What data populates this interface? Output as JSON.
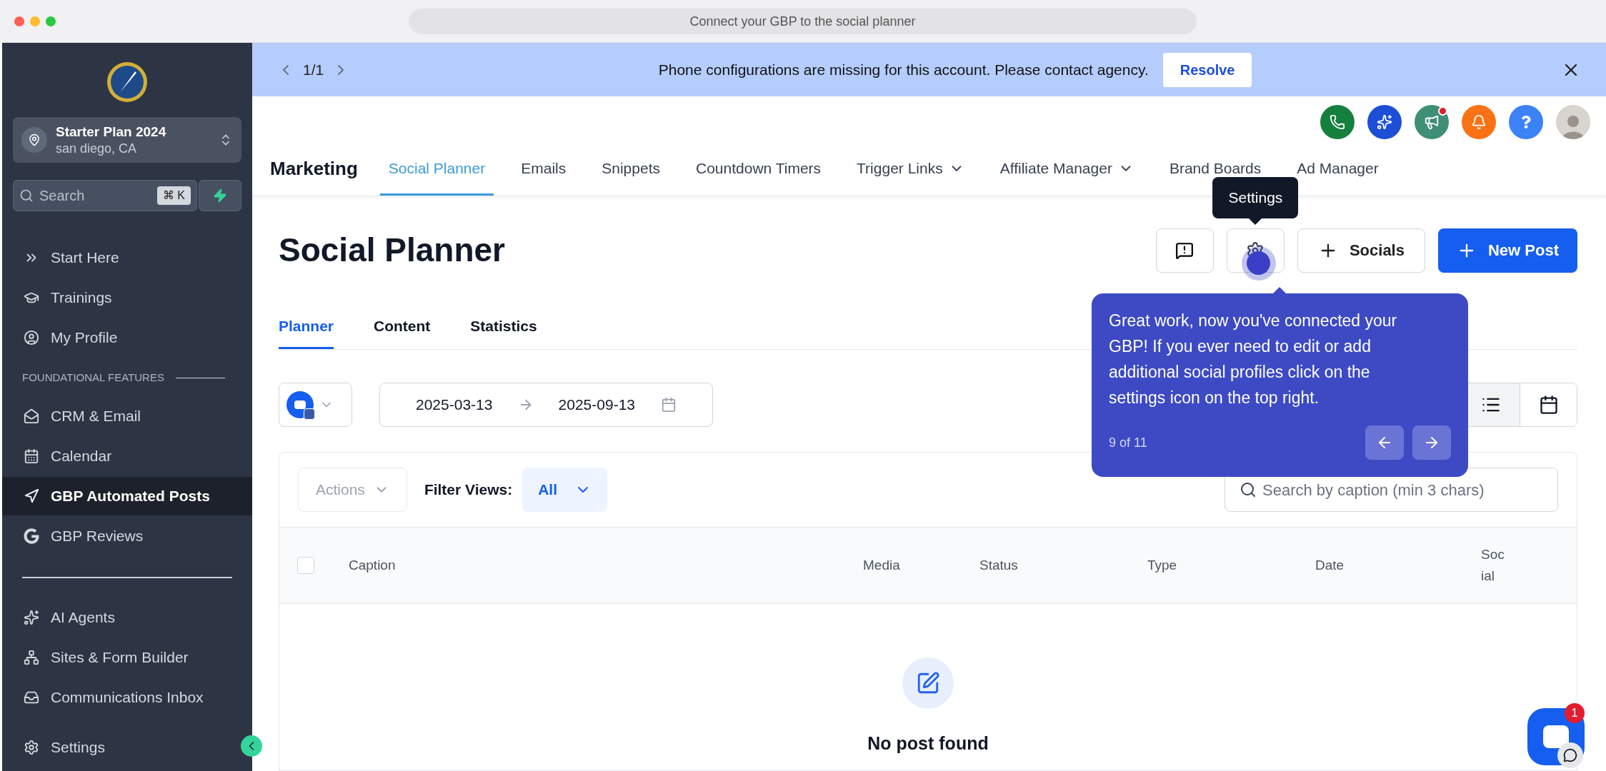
{
  "browser": {
    "address": "Connect your GBP to the social planner"
  },
  "sidebar": {
    "account": {
      "name": "Starter Plan 2024",
      "location": "san diego, CA"
    },
    "search": {
      "placeholder": "Search",
      "shortcut": "⌘ K"
    },
    "groups": [
      {
        "items": [
          {
            "label": "Start Here",
            "selected": false
          },
          {
            "label": "Trainings",
            "selected": false
          },
          {
            "label": "My Profile",
            "selected": false
          }
        ]
      },
      {
        "label": "FOUNDATIONAL FEATURES",
        "items": [
          {
            "label": "CRM & Email",
            "selected": false
          },
          {
            "label": "Calendar",
            "selected": false
          },
          {
            "label": "GBP Automated Posts",
            "selected": true
          },
          {
            "label": "GBP Reviews",
            "selected": false
          }
        ]
      },
      {
        "items": [
          {
            "label": "AI Agents",
            "selected": false
          },
          {
            "label": "Sites & Form Builder",
            "selected": false
          },
          {
            "label": "Communications Inbox",
            "selected": false
          }
        ]
      }
    ],
    "footer": {
      "label": "Settings",
      "selected": false
    }
  },
  "banner": {
    "pager": "1/1",
    "message": "Phone configurations are missing for this account. Please contact agency.",
    "action": "Resolve"
  },
  "nav": {
    "title": "Marketing",
    "tabs": [
      {
        "label": "Social Planner",
        "selected": true,
        "dropdown": false
      },
      {
        "label": "Emails",
        "selected": false,
        "dropdown": false
      },
      {
        "label": "Snippets",
        "selected": false,
        "dropdown": false
      },
      {
        "label": "Countdown Timers",
        "selected": false,
        "dropdown": false
      },
      {
        "label": "Trigger Links",
        "selected": false,
        "dropdown": true
      },
      {
        "label": "Affiliate Manager",
        "selected": false,
        "dropdown": true
      },
      {
        "label": "Brand Boards",
        "selected": false,
        "dropdown": false
      },
      {
        "label": "Ad Manager",
        "selected": false,
        "dropdown": false
      }
    ]
  },
  "page": {
    "title": "Social Planner",
    "socials": "Socials",
    "new_post": "New Post",
    "tabs": [
      {
        "label": "Planner",
        "selected": true
      },
      {
        "label": "Content",
        "selected": false
      },
      {
        "label": "Statistics",
        "selected": false
      }
    ],
    "date_from": "2025-03-13",
    "date_to": "2025-09-13",
    "views": [
      {
        "kind": "list",
        "selected": true
      },
      {
        "kind": "calendar",
        "selected": false
      }
    ]
  },
  "table": {
    "actions": "Actions",
    "filter_label": "Filter Views:",
    "filter_value": "All",
    "search_placeholder": "Search by caption (min 3 chars)",
    "all_checked": false,
    "columns": [
      "Caption",
      "Media",
      "Status",
      "Type",
      "Date",
      "Social"
    ],
    "empty": "No post found"
  },
  "tooltip": {
    "text": "Settings"
  },
  "tour": {
    "text": "Great work, now you've connected your GBP! If you ever need to edit or add additional social profiles click on the settings icon on the top right.",
    "step": "9 of 11"
  },
  "chat": {
    "badge": "1"
  }
}
